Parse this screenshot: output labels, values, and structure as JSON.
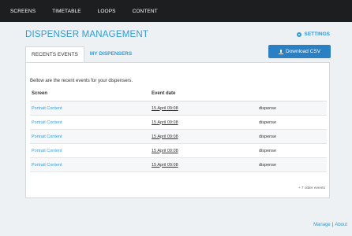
{
  "nav": {
    "items": [
      "SCREENS",
      "TIMETABLE",
      "LOOPS",
      "CONTENT"
    ]
  },
  "header": {
    "title": "DISPENSER MANAGEMENT",
    "settings_label": "SETTINGS"
  },
  "tabs": [
    {
      "label": "RECENTS EVENTS",
      "active": true
    },
    {
      "label": "MY DISPENSERS",
      "active": false
    }
  ],
  "download_button": {
    "label": "Download CSV"
  },
  "panel": {
    "intro": "Bellow are the recent events for your dispensers.",
    "columns": [
      "Screen",
      "Event date",
      ""
    ],
    "rows": [
      {
        "screen": "Portrait Content",
        "date": "15 April 09:08",
        "event": "dispense"
      },
      {
        "screen": "Portrait Content",
        "date": "15 April 09:08",
        "event": "dispense"
      },
      {
        "screen": "Portrait Content",
        "date": "15 April 09:08",
        "event": "dispense"
      },
      {
        "screen": "Portrait Content",
        "date": "15 April 09:08",
        "event": "dispense"
      },
      {
        "screen": "Portrait Content",
        "date": "15 April 09:08",
        "event": "dispense"
      }
    ],
    "older_events": "+ 7 older events"
  },
  "footer": {
    "manage": "Manage",
    "separator": "|",
    "about": "About"
  },
  "colors": {
    "accent": "#2e9bd5",
    "button": "#2b80c3",
    "nav_bg": "#1d1e20",
    "page_bg": "#eef1f3"
  }
}
